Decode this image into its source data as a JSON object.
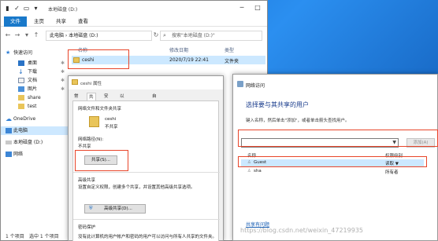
{
  "explorer": {
    "title": "本地磁盘 (D:)",
    "ribbon_tabs": [
      "文件",
      "主页",
      "共享",
      "查看"
    ],
    "address_path": "此电脑 › 本地磁盘 (D:)",
    "search_placeholder": "搜索\"本地磁盘 (D:)\"",
    "columns": {
      "name": "名称",
      "modified": "修改日期",
      "type": "类型"
    },
    "file": {
      "name": "ceshi",
      "modified": "2020/7/19 22:41",
      "type": "文件夹"
    },
    "sidebar": [
      "快速访问",
      "桌面",
      "下载",
      "文档",
      "图片",
      "share",
      "test",
      "OneDrive",
      "此电脑",
      "本地磁盘 (D:)",
      "网络"
    ],
    "status_count": "1 个项目",
    "status_selected": "选中 1 个项目"
  },
  "properties": {
    "title": "ceshi 属性",
    "tabs": [
      "常规",
      "共享",
      "安全",
      "以前的版本",
      "自定义"
    ],
    "section_file_sharing": "网络文件和文件夹共享",
    "folder_name": "ceshi",
    "folder_status": "不共享",
    "network_path_label": "网络路径(N):",
    "network_path_value": "不共享",
    "share_button": "共享(S)...",
    "section_advanced": "高级共享",
    "advanced_desc": "设置自定义权限，创建多个共享，并设置其他高级共享选项。",
    "advanced_button": "高级共享(D)...",
    "section_password": "密码保护",
    "password_desc": "没有此计算机的用户帐户和密码的用户可以访问与所有人共享的文件夹。"
  },
  "network_access": {
    "title": "网络访问",
    "heading": "选择要与其共享的用户",
    "desc": "键入名称，然后单击\"添加\"，或者单击箭头查找用户。",
    "add_button": "添加(A)",
    "col_name": "名称",
    "col_perm": "权限级别",
    "users": [
      {
        "name": "Guest",
        "perm": "读取 ▼"
      },
      {
        "name": "sha",
        "perm": "所有者"
      }
    ],
    "link": "共享有问题"
  },
  "watermark": "https://blog.csdn.net/weixin_47219935"
}
